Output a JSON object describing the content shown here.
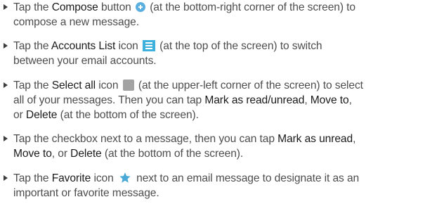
{
  "icons": {
    "compose": "compose-icon",
    "accounts_list": "accounts-list-icon",
    "select_all": "select-all-icon",
    "favorite": "star-icon"
  },
  "colors": {
    "compose_icon": "#5aaee0",
    "accounts_icon": "#3db0dc",
    "select_all_icon": "#a3a3a3",
    "favorite_icon": "#4aa9d6",
    "text": "#4d4d4d",
    "keyword": "#1a1a1a"
  },
  "bullets": [
    {
      "line1": {
        "pre": "Tap the ",
        "kw": "Compose",
        "post": " button ",
        "after_icon": " (at the bottom-right corner of the screen) to"
      },
      "line2": "compose a new message."
    },
    {
      "line1": {
        "pre": "Tap the ",
        "kw": "Accounts List",
        "post": " icon ",
        "after_icon": " (at the top of the screen) to switch"
      },
      "line2": "between your email accounts."
    },
    {
      "line1": {
        "pre": "Tap the ",
        "kw": "Select all",
        "post": " icon ",
        "after_icon": " (at the upper-left corner of the screen) to select"
      },
      "line2": {
        "pre": "all of your messages. Then you can tap ",
        "kw1": "Mark as read/unread",
        "mid": ", ",
        "kw2": "Move to",
        "post": ","
      },
      "line3": {
        "pre": "or ",
        "kw": "Delete",
        "post": " (at the bottom of the screen)."
      }
    },
    {
      "line1": {
        "pre": "Tap the checkbox next to a message, then you can tap ",
        "kw": "Mark as unread",
        "post": ","
      },
      "line2": {
        "kw1": "Move to",
        "mid": ", or ",
        "kw2": "Delete",
        "post": " (at the bottom of the screen)."
      }
    },
    {
      "line1": {
        "pre": "Tap the ",
        "kw": "Favorite",
        "post": " icon ",
        "after_icon": " next to an email message to designate it as an"
      },
      "line2": "important or favorite message."
    }
  ]
}
